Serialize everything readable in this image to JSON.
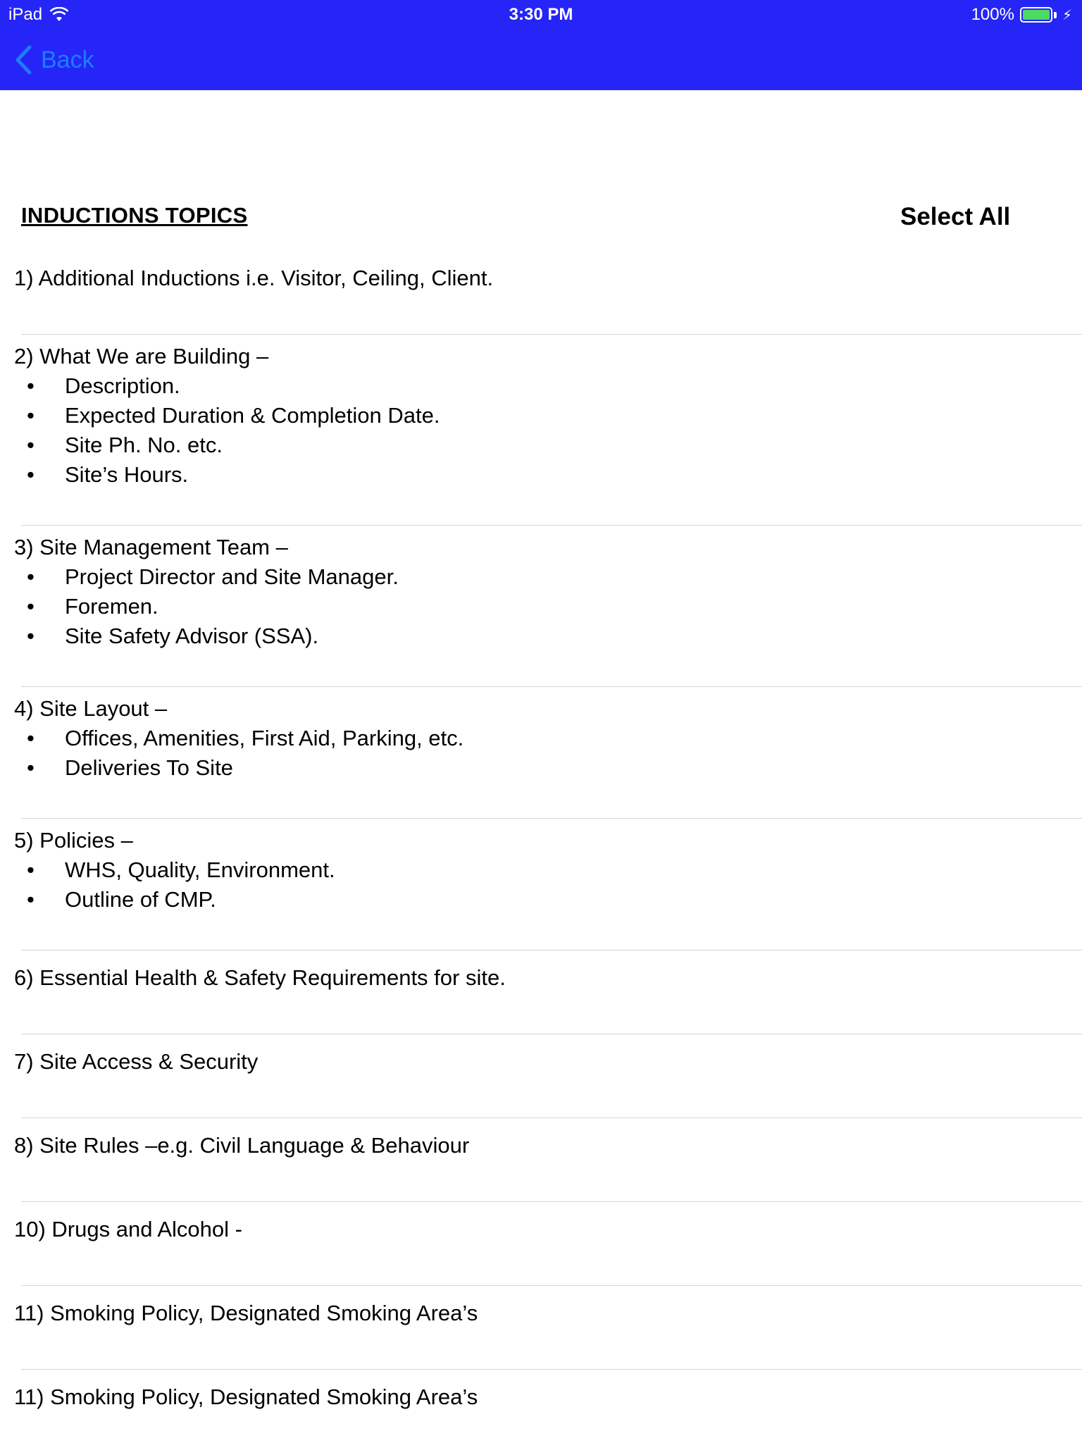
{
  "status_bar": {
    "device": "iPad",
    "time": "3:30 PM",
    "battery": "100%"
  },
  "nav": {
    "back_label": "Back"
  },
  "title": "INDUCTIONS TOPICS",
  "select_all": "Select All",
  "topics": [
    {
      "heading": "1) Additional Inductions i.e. Visitor, Ceiling, Client.",
      "bullets": []
    },
    {
      "heading": "2) What We are Building –",
      "bullets": [
        "Description.",
        "Expected Duration & Completion Date.",
        "Site Ph. No. etc.",
        "Site’s Hours."
      ]
    },
    {
      "heading": "3) Site Management Team –",
      "bullets": [
        "Project Director and Site Manager.",
        "Foremen.",
        "Site Safety Advisor (SSA)."
      ]
    },
    {
      "heading": "4) Site Layout –",
      "bullets": [
        "Offices, Amenities, First Aid, Parking, etc.",
        "Deliveries To Site"
      ]
    },
    {
      "heading": "5) Policies –",
      "bullets": [
        "WHS, Quality, Environment.",
        "Outline of CMP."
      ]
    },
    {
      "heading": "6) Essential Health & Safety Requirements for site.",
      "bullets": []
    },
    {
      "heading": "7) Site Access & Security",
      "bullets": []
    },
    {
      "heading": "8) Site Rules –e.g. Civil Language & Behaviour",
      "bullets": []
    },
    {
      "heading": "10) Drugs and Alcohol -",
      "bullets": []
    },
    {
      "heading": "11) Smoking Policy, Designated Smoking Area’s",
      "bullets": []
    },
    {
      "heading": "11) Smoking Policy, Designated Smoking Area’s",
      "bullets": []
    }
  ],
  "bullet_char": "•"
}
